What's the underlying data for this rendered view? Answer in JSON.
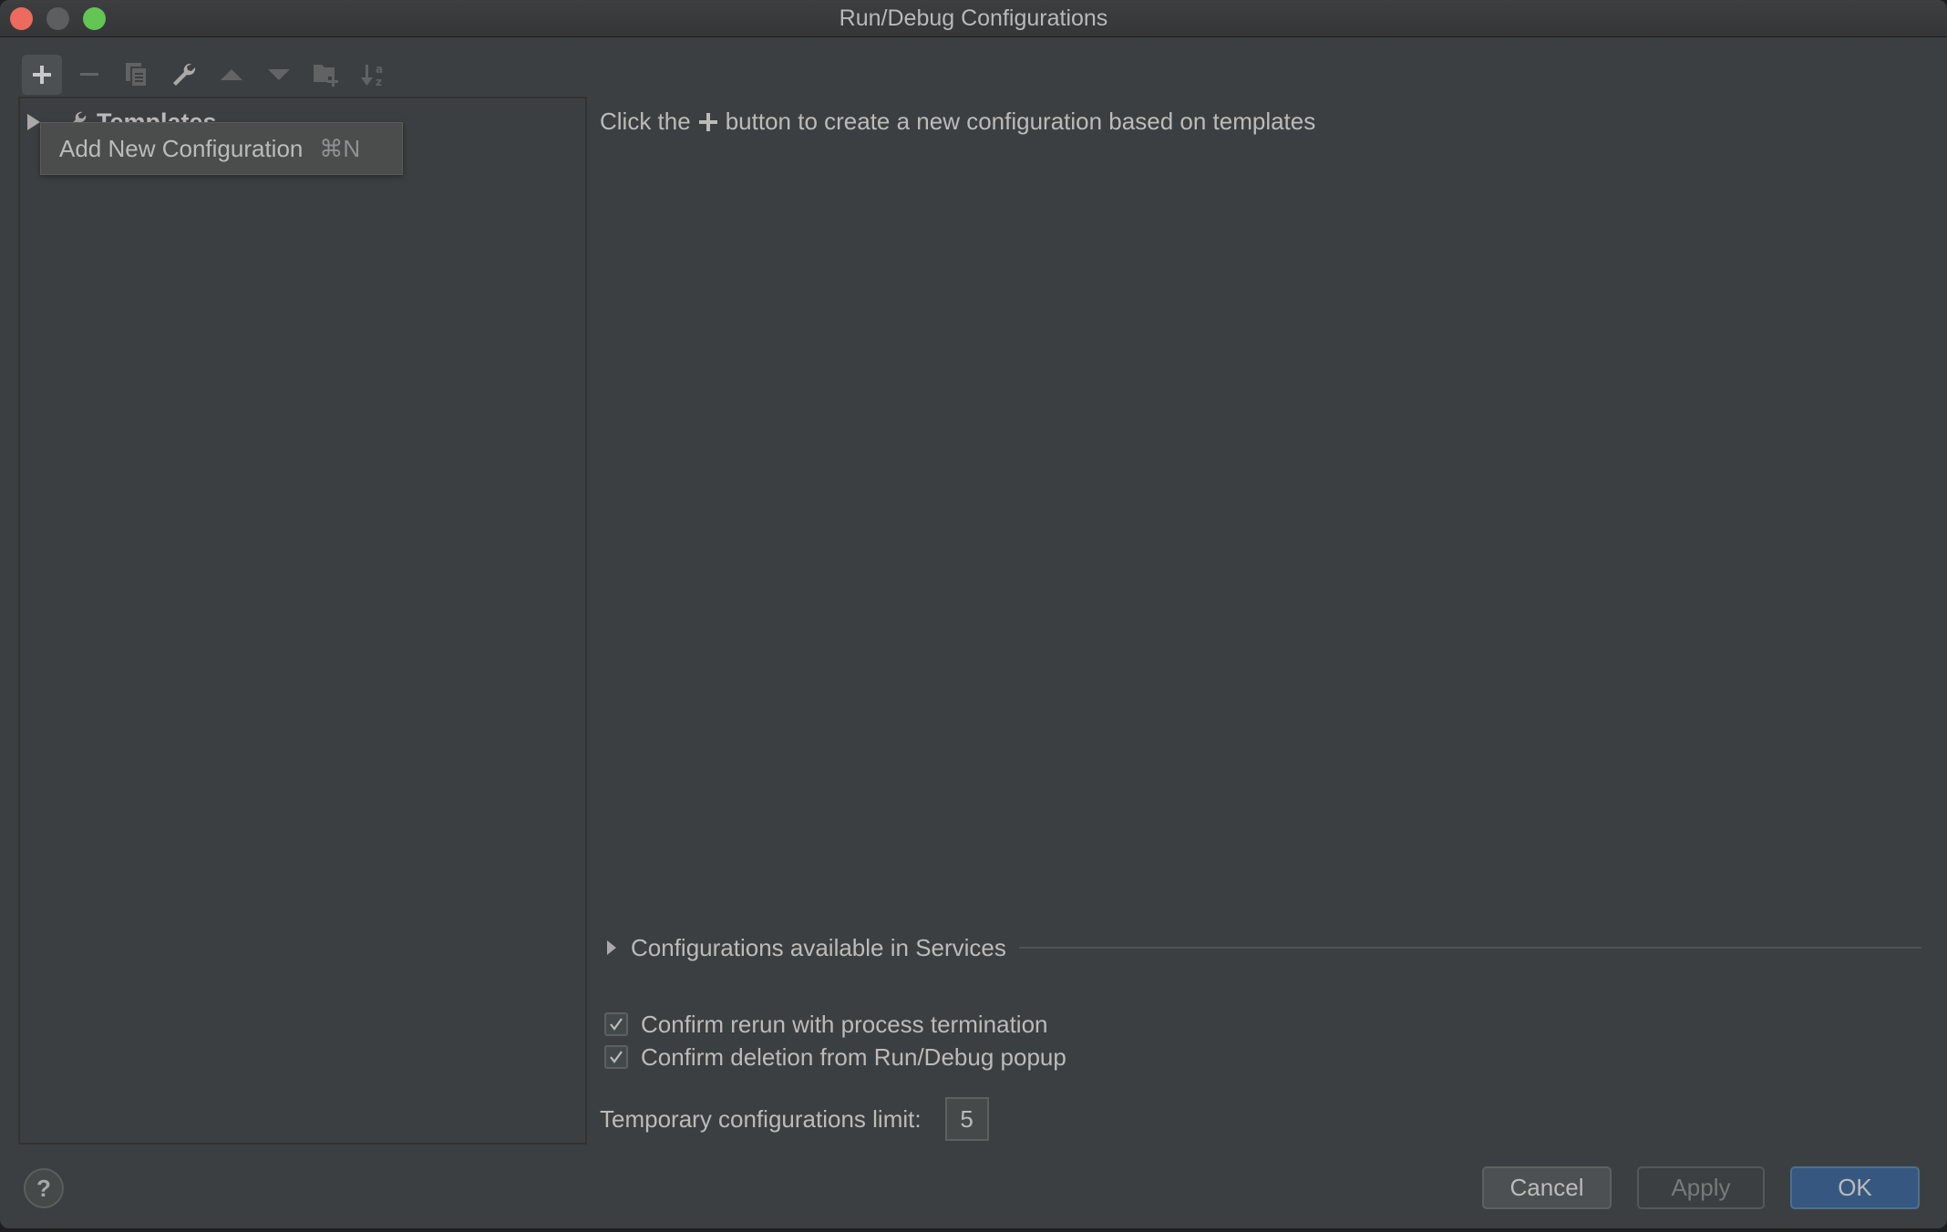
{
  "window": {
    "title": "Run/Debug Configurations",
    "traffic_lights": [
      "close",
      "minimize",
      "maximize"
    ]
  },
  "toolbar": {
    "buttons": [
      {
        "name": "add",
        "icon": "plus-icon",
        "active": true
      },
      {
        "name": "remove",
        "icon": "minus-icon",
        "enabled": false
      },
      {
        "name": "copy",
        "icon": "copy-icon",
        "enabled": false
      },
      {
        "name": "edit-templates",
        "icon": "wrench-icon",
        "enabled": true
      },
      {
        "name": "move-up",
        "icon": "arrow-up-icon",
        "enabled": false
      },
      {
        "name": "move-down",
        "icon": "arrow-down-icon",
        "enabled": false
      },
      {
        "name": "new-folder",
        "icon": "folder-add-icon",
        "enabled": false
      },
      {
        "name": "sort",
        "icon": "sort-alpha-icon",
        "enabled": false
      }
    ]
  },
  "tree": {
    "items": [
      {
        "label": "Templates",
        "icon": "wrench-icon",
        "expanded": false
      }
    ]
  },
  "tooltip": {
    "label": "Add New Configuration",
    "shortcut": "⌘N"
  },
  "main": {
    "hint_before": "Click the",
    "hint_after": "button to create a new configuration based on templates",
    "services_label": "Configurations available in Services",
    "checkboxes": [
      {
        "label": "Confirm rerun with process termination",
        "checked": true
      },
      {
        "label": "Confirm deletion from Run/Debug popup",
        "checked": true
      }
    ],
    "temp_limit_label": "Temporary configurations limit:",
    "temp_limit_value": "5"
  },
  "footer": {
    "help_label": "?",
    "cancel_label": "Cancel",
    "apply_label": "Apply",
    "ok_label": "OK"
  },
  "colors": {
    "background": "#3c3f41",
    "primary_button": "#365880",
    "text": "#bbbbbb",
    "close": "#ed6a5e",
    "maximize": "#62c554"
  }
}
